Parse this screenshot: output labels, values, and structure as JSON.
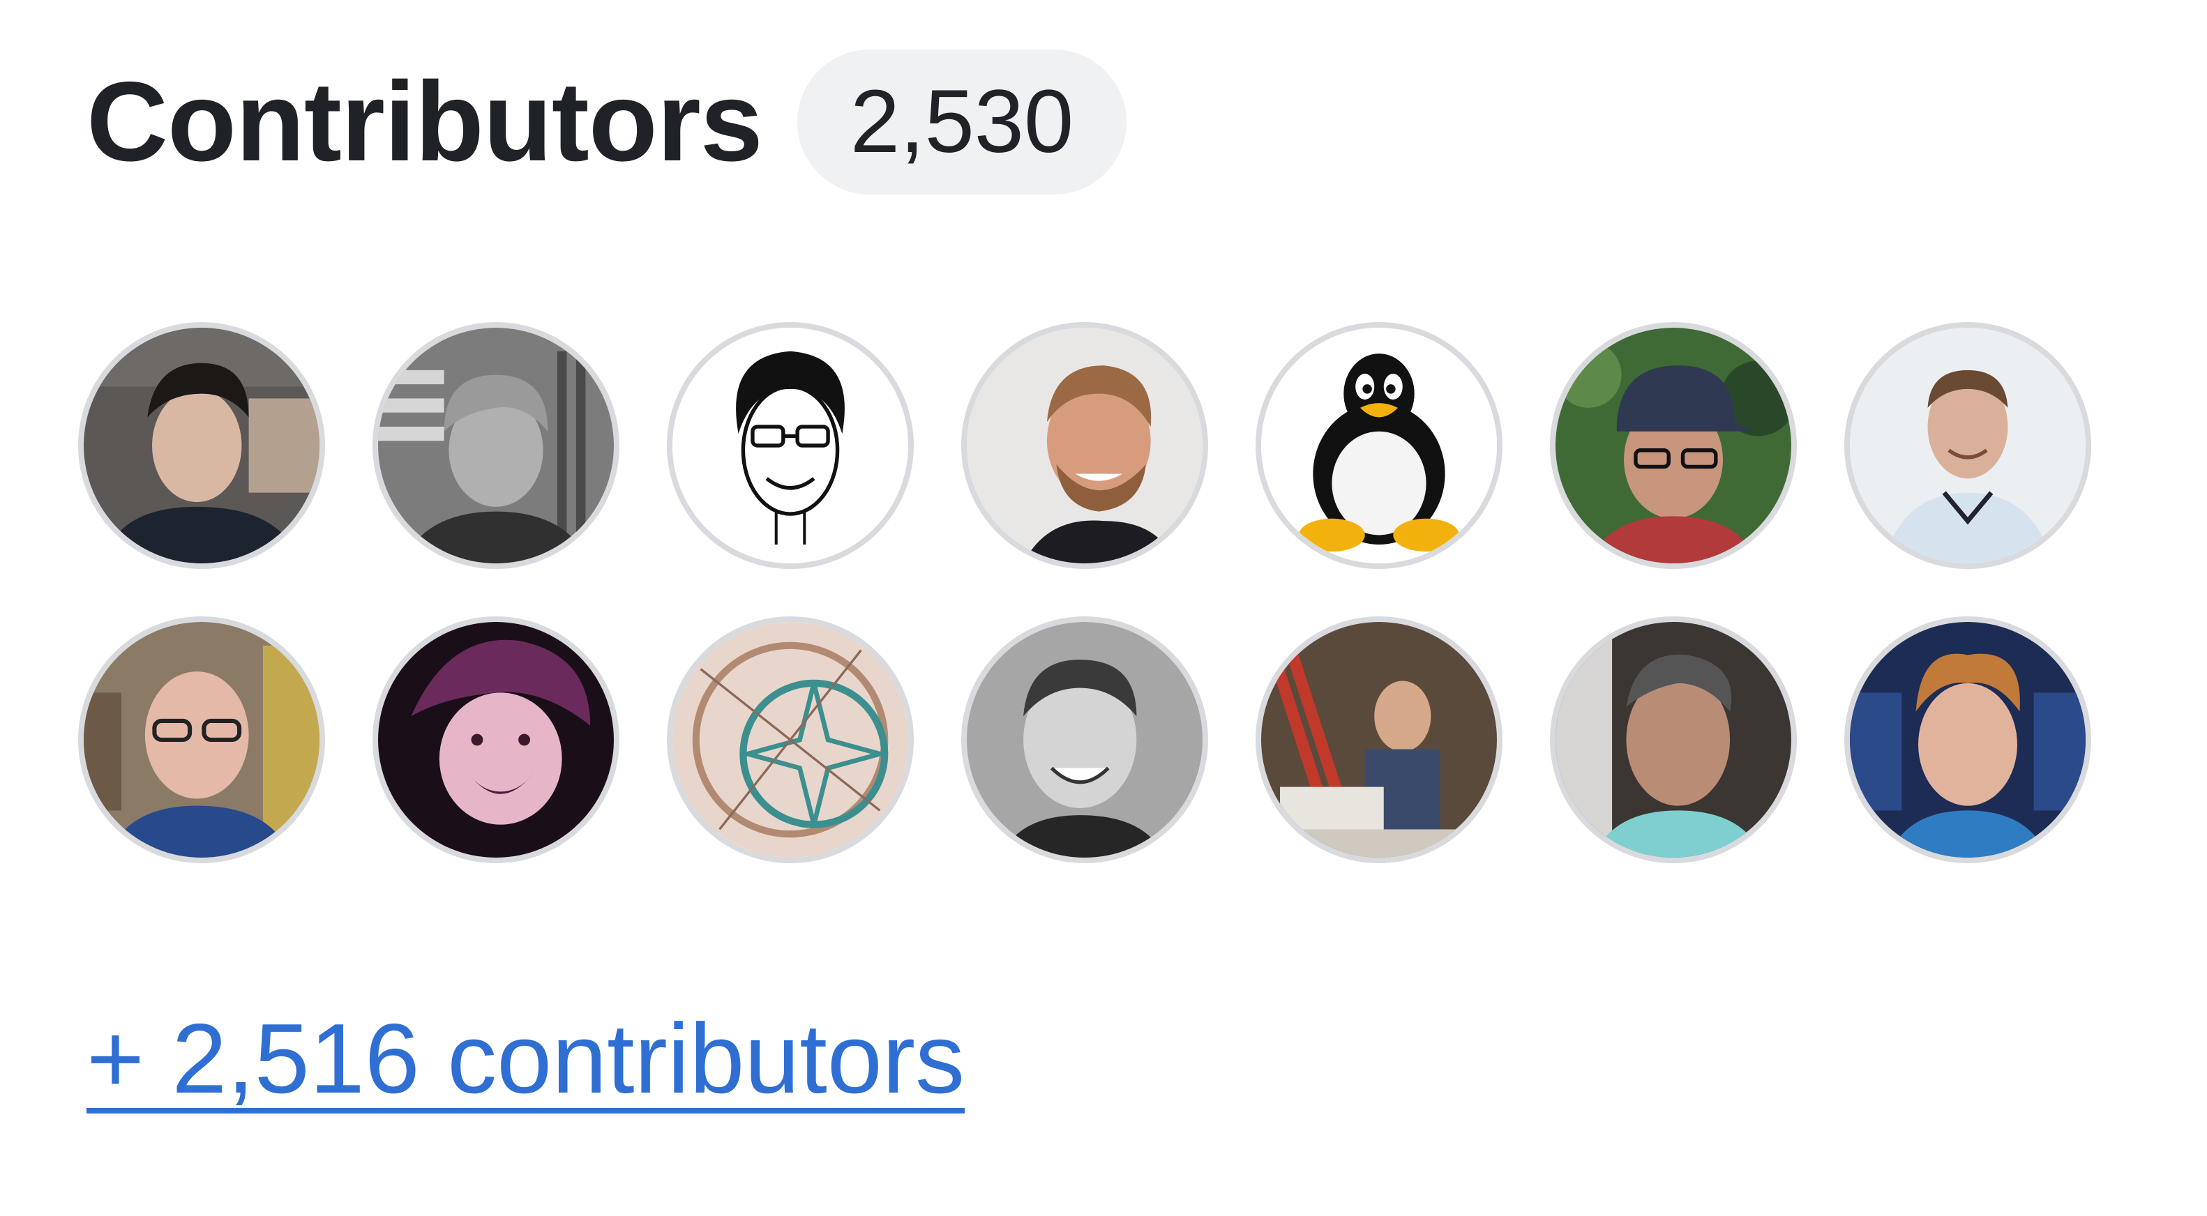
{
  "header": {
    "title": "Contributors",
    "count": "2,530"
  },
  "avatars": [
    {
      "icon": "contributor-avatar-icon"
    },
    {
      "icon": "contributor-avatar-icon"
    },
    {
      "icon": "cartoon-face-avatar-icon"
    },
    {
      "icon": "contributor-avatar-icon"
    },
    {
      "icon": "tux-penguin-icon"
    },
    {
      "icon": "contributor-avatar-icon"
    },
    {
      "icon": "contributor-avatar-icon"
    },
    {
      "icon": "contributor-avatar-icon"
    },
    {
      "icon": "child-avatar-icon"
    },
    {
      "icon": "dreamcatcher-avatar-icon"
    },
    {
      "icon": "contributor-avatar-icon"
    },
    {
      "icon": "contributor-avatar-icon"
    },
    {
      "icon": "contributor-avatar-icon"
    },
    {
      "icon": "contributor-avatar-icon"
    }
  ],
  "more_link": {
    "label": "+ 2,516 contributors"
  },
  "colors": {
    "link": "#2f6fd3",
    "counter_bg": "#eff1f3",
    "text": "#1f2328"
  }
}
